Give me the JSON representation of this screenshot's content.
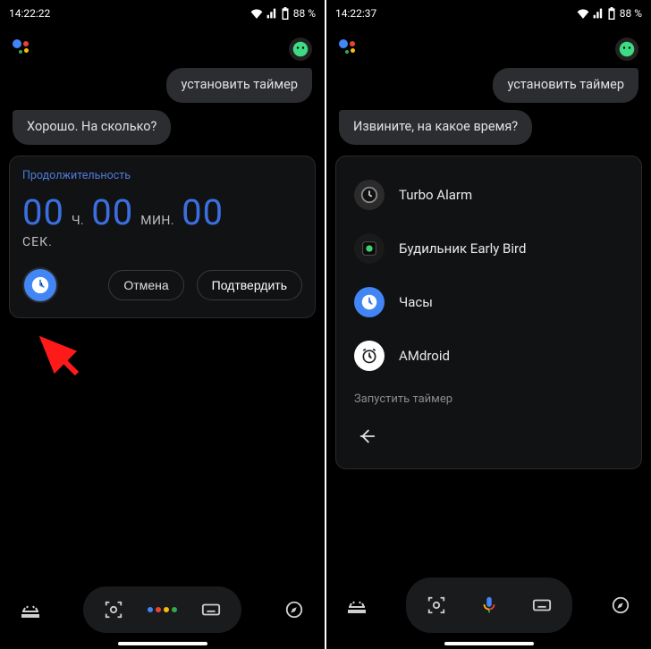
{
  "screens": {
    "left": {
      "status": {
        "time": "14:22:22",
        "battery": "88 %"
      },
      "user_msg": "установить таймер",
      "assistant_msg": "Хорошо. На сколько?",
      "duration_card": {
        "label": "Продолжительность",
        "hours": "00",
        "hours_unit": "Ч.",
        "minutes": "00",
        "minutes_unit": "МИН.",
        "seconds": "00",
        "seconds_unit": "СЕК."
      },
      "cancel": "Отмена",
      "confirm": "Подтвердить"
    },
    "right": {
      "status": {
        "time": "14:22:37",
        "battery": "88 %"
      },
      "user_msg": "установить таймер",
      "assistant_msg": "Извините, на какое время?",
      "apps": [
        {
          "name": "Turbo Alarm"
        },
        {
          "name": "Будильник Early Bird"
        },
        {
          "name": "Часы"
        },
        {
          "name": "AMdroid"
        }
      ],
      "hint": "Запустить таймер"
    }
  }
}
